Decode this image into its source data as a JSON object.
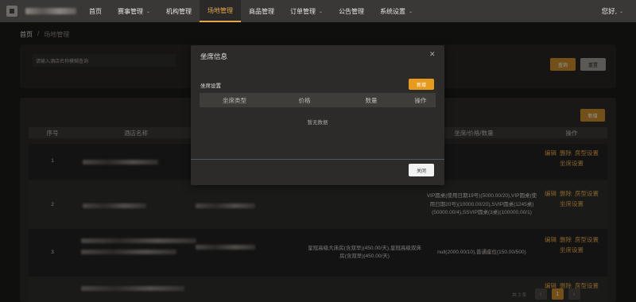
{
  "header": {
    "nav": [
      {
        "label": "首页",
        "has_dropdown": false
      },
      {
        "label": "赛事管理",
        "has_dropdown": true
      },
      {
        "label": "机构管理",
        "has_dropdown": false
      },
      {
        "label": "场地管理",
        "has_dropdown": false,
        "active": true
      },
      {
        "label": "商品管理",
        "has_dropdown": false
      },
      {
        "label": "订单管理",
        "has_dropdown": true
      },
      {
        "label": "公告管理",
        "has_dropdown": false
      },
      {
        "label": "系统设置",
        "has_dropdown": true
      }
    ],
    "greeting": "您好,",
    "accent_color": "#e3a74a"
  },
  "breadcrumb": {
    "home": "首页",
    "separator": "/",
    "current": "场地管理"
  },
  "search": {
    "placeholder": "请输入酒店名称模糊查询",
    "search_label": "查询",
    "reset_label": "重置"
  },
  "table": {
    "add_label": "新增",
    "columns": [
      "序号",
      "酒店名称",
      "",
      "",
      "坐席/价格/数量",
      "操作"
    ],
    "rows": [
      {
        "index": "1",
        "package": "",
        "seats": ""
      },
      {
        "index": "2",
        "package": "",
        "seats": "VIP圆桌(使用日期19号)(5000.00/20),VIP圆桌(使用日期20号)(10000.00/20),SVIP圆桌(1245桌)(50000.00/4),SSVIP圆桌(3桌)(100000.00/1)"
      },
      {
        "index": "3",
        "package": "皇冠高级大床房(含双早)(450.00/天),皇冠高级双床房(含双早)(450.00/天)",
        "seats": "null(2000.00/10),普通座位(150.00/500)"
      },
      {
        "index": "",
        "package": "",
        "seats": ""
      }
    ],
    "ops": {
      "edit": "编辑",
      "delete": "删除",
      "room": "房型设置",
      "seat": "坐席设置"
    }
  },
  "pagination": {
    "total": "共 3 条",
    "prev": "‹",
    "current": "1",
    "next": "›"
  },
  "modal": {
    "title": "坐席信息",
    "close_icon": "close-icon",
    "section_label": "坐席设置",
    "add_label": "新增",
    "columns": [
      "坐席类型",
      "价格",
      "数量",
      "操作"
    ],
    "empty_text": "暂无数据",
    "close_label": "关闭"
  }
}
